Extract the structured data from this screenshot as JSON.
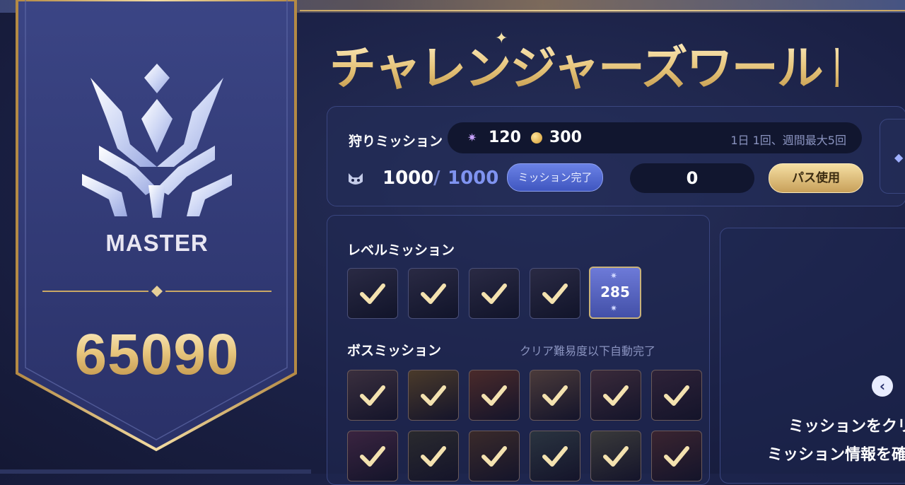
{
  "rank": {
    "name": "MASTER",
    "score": "65090"
  },
  "title": "チャレンジャーズワールド",
  "hunting_mission": {
    "label": "狩りミッション",
    "reward_1": "120",
    "reward_2": "300",
    "limit_text": "1日 1回、週間最大5回",
    "stamina_current": "1000",
    "stamina_separator": "/",
    "stamina_max": "1000",
    "complete_button": "ミッション完了",
    "count_value": "0",
    "pass_button": "パス使用"
  },
  "level_mission": {
    "title": "レベルミッション",
    "completed_count": 4,
    "current_level": "285"
  },
  "boss_mission": {
    "title": "ボスミッション",
    "note": "クリア難易度以下自動完了",
    "completed_count": 12
  },
  "info_panel": {
    "line1": "ミッションをクリ",
    "line2": "ミッション情報を確"
  },
  "colors": {
    "gold": "#e6c47a",
    "accent_blue": "#7f93f0",
    "background": "#1b2146"
  },
  "icons": [
    "rank-emblem-icon",
    "reward-crystal-icon",
    "coin-icon",
    "cat-mask-icon",
    "checkmark-icon",
    "arrow-left-icon"
  ]
}
